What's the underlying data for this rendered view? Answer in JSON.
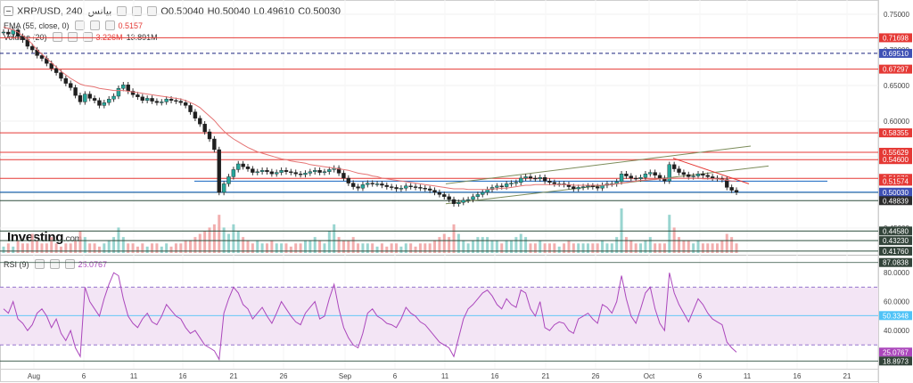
{
  "header": {
    "symbol": "XRP/USD, 240, بيانس",
    "ohlc": {
      "o": "O0.50040",
      "h": "H0.50040",
      "l": "L0.49610",
      "c": "C0.50030"
    },
    "ema_label": "EMA (55, close, 0)",
    "ema_value": "0.5157",
    "volume_label": "Volume (20)",
    "volume_value1": "3.226M",
    "volume_value2": "13.891M",
    "rsi_label": "RSI (9)",
    "rsi_value": "25.0767",
    "logo": "Investing",
    "logo_suffix": ".com"
  },
  "colors": {
    "up": "#26a69a",
    "down": "#1f1f1f",
    "ema": "#e57373",
    "resistance": "#e53935",
    "current_line": "#1565c0",
    "dashed_line": "#1a237e",
    "channel": "#7c8c5a",
    "rsi_line": "#ab47bc",
    "rsi_band": "#f3e5f5",
    "label_red": "#e53935",
    "label_blue": "#3f51b5",
    "label_dark": "#2b2b2b",
    "label_darkgreen": "#33443a"
  },
  "chart_data": [
    {
      "type": "candlestick",
      "title": "XRP/USD, 240",
      "ylim": [
        0.415,
        0.76
      ],
      "y_axis_ticks": [
        "0.75000",
        "0.70000",
        "0.65000",
        "0.60000",
        "0.55000",
        "0.50000",
        "0.45000"
      ],
      "x_axis_ticks": [
        "Aug",
        "6",
        "11",
        "16",
        "21",
        "26",
        "Sep",
        "6",
        "11",
        "16",
        "21",
        "26",
        "Oct",
        "6",
        "11",
        "16",
        "21"
      ],
      "price_labels": [
        {
          "value": 0.71698,
          "text": "0.71698",
          "style": "red"
        },
        {
          "value": 0.6951,
          "text": "0.69510",
          "style": "blue"
        },
        {
          "value": 0.67297,
          "text": "0.67297",
          "style": "red"
        },
        {
          "value": 0.58355,
          "text": "0.58355",
          "style": "red"
        },
        {
          "value": 0.55629,
          "text": "0.55629",
          "style": "red"
        },
        {
          "value": 0.546,
          "text": "0.54600",
          "style": "red"
        },
        {
          "value": 0.5197,
          "text": "0.51970",
          "style": "red"
        },
        {
          "value": 0.51574,
          "text": "0.51574",
          "style": "red"
        },
        {
          "value": 0.5,
          "text": "0.50000",
          "style": "dark"
        },
        {
          "value": 0.5003,
          "text": "0.50030",
          "style": "blue"
        },
        {
          "value": 0.48839,
          "text": "0.48839",
          "style": "dark"
        },
        {
          "value": 0.4458,
          "text": "0.44580",
          "style": "darkgreen"
        },
        {
          "value": 0.4323,
          "text": "0.43230",
          "style": "darkgreen"
        },
        {
          "value": 0.4176,
          "text": "0.41760",
          "style": "darkgreen"
        }
      ],
      "close_series": [
        0.725,
        0.722,
        0.728,
        0.719,
        0.714,
        0.705,
        0.7,
        0.692,
        0.688,
        0.681,
        0.674,
        0.668,
        0.66,
        0.653,
        0.647,
        0.636,
        0.627,
        0.638,
        0.632,
        0.629,
        0.622,
        0.626,
        0.631,
        0.635,
        0.646,
        0.651,
        0.642,
        0.637,
        0.634,
        0.629,
        0.632,
        0.628,
        0.626,
        0.627,
        0.631,
        0.629,
        0.628,
        0.626,
        0.622,
        0.613,
        0.604,
        0.596,
        0.585,
        0.575,
        0.56,
        0.5,
        0.512,
        0.522,
        0.532,
        0.54,
        0.536,
        0.533,
        0.528,
        0.529,
        0.531,
        0.529,
        0.526,
        0.528,
        0.531,
        0.529,
        0.528,
        0.526,
        0.525,
        0.527,
        0.529,
        0.531,
        0.528,
        0.529,
        0.532,
        0.534,
        0.527,
        0.52,
        0.513,
        0.508,
        0.506,
        0.511,
        0.513,
        0.512,
        0.512,
        0.51,
        0.508,
        0.507,
        0.505,
        0.506,
        0.509,
        0.508,
        0.507,
        0.506,
        0.505,
        0.503,
        0.5,
        0.497,
        0.494,
        0.49,
        0.484,
        0.486,
        0.489,
        0.49,
        0.494,
        0.497,
        0.5,
        0.504,
        0.507,
        0.509,
        0.508,
        0.512,
        0.513,
        0.514,
        0.52,
        0.522,
        0.52,
        0.519,
        0.521,
        0.516,
        0.514,
        0.512,
        0.512,
        0.511,
        0.508,
        0.505,
        0.507,
        0.508,
        0.509,
        0.508,
        0.506,
        0.51,
        0.512,
        0.512,
        0.515,
        0.526,
        0.523,
        0.52,
        0.519,
        0.521,
        0.526,
        0.528,
        0.524,
        0.52,
        0.516,
        0.539,
        0.533,
        0.528,
        0.525,
        0.522,
        0.523,
        0.526,
        0.524,
        0.522,
        0.52,
        0.519,
        0.518,
        0.507,
        0.503,
        0.5003
      ],
      "volume_series": [
        2,
        3,
        2,
        4,
        3,
        3,
        6,
        4,
        3,
        3,
        5,
        3,
        2,
        3,
        3,
        4,
        7,
        5,
        3,
        3,
        2,
        3,
        4,
        5,
        8,
        5,
        3,
        3,
        2,
        3,
        2,
        3,
        3,
        2,
        3,
        2,
        3,
        3,
        4,
        4,
        5,
        6,
        7,
        8,
        9,
        12,
        8,
        6,
        9,
        7,
        5,
        4,
        3,
        4,
        3,
        3,
        4,
        3,
        3,
        3,
        2,
        3,
        3,
        4,
        4,
        5,
        4,
        3,
        7,
        9,
        5,
        4,
        4,
        5,
        3,
        3,
        3,
        3,
        2,
        3,
        2,
        3,
        3,
        2,
        3,
        3,
        2,
        3,
        3,
        3,
        4,
        5,
        6,
        5,
        9,
        6,
        4,
        3,
        4,
        5,
        5,
        5,
        4,
        4,
        3,
        4,
        4,
        5,
        6,
        5,
        3,
        3,
        4,
        3,
        3,
        3,
        2,
        3,
        4,
        3,
        3,
        3,
        3,
        3,
        3,
        4,
        3,
        3,
        5,
        14,
        5,
        4,
        3,
        3,
        4,
        5,
        3,
        3,
        3,
        12,
        8,
        5,
        4,
        4,
        3,
        4,
        3,
        3,
        3,
        3,
        4,
        6,
        5,
        3
      ],
      "ema_series": [
        0.732,
        0.73,
        0.728,
        0.725,
        0.72,
        0.715,
        0.708,
        0.7,
        0.694,
        0.688,
        0.682,
        0.676,
        0.67,
        0.665,
        0.66,
        0.656,
        0.652,
        0.65,
        0.649,
        0.648,
        0.646,
        0.645,
        0.644,
        0.643,
        0.643,
        0.643,
        0.642,
        0.641,
        0.64,
        0.639,
        0.638,
        0.637,
        0.636,
        0.635,
        0.634,
        0.633,
        0.632,
        0.631,
        0.629,
        0.626,
        0.623,
        0.619,
        0.613,
        0.607,
        0.601,
        0.593,
        0.586,
        0.58,
        0.575,
        0.571,
        0.567,
        0.563,
        0.56,
        0.557,
        0.555,
        0.553,
        0.551,
        0.549,
        0.547,
        0.546,
        0.544,
        0.543,
        0.542,
        0.541,
        0.539,
        0.538,
        0.537,
        0.536,
        0.535,
        0.534,
        0.533,
        0.532,
        0.531,
        0.529,
        0.527,
        0.526,
        0.525,
        0.523,
        0.522,
        0.52,
        0.519,
        0.518,
        0.517,
        0.516,
        0.515,
        0.514,
        0.513,
        0.512,
        0.511,
        0.51,
        0.509,
        0.508,
        0.507,
        0.506,
        0.505,
        0.505,
        0.505,
        0.504,
        0.504,
        0.504,
        0.504,
        0.504,
        0.505,
        0.505,
        0.506,
        0.506,
        0.507,
        0.508,
        0.509,
        0.51,
        0.51,
        0.511,
        0.511,
        0.511,
        0.511,
        0.511,
        0.511,
        0.511,
        0.511,
        0.51,
        0.51,
        0.51,
        0.51,
        0.51,
        0.51,
        0.51,
        0.511,
        0.511,
        0.512,
        0.513,
        0.514,
        0.515,
        0.516,
        0.517,
        0.517,
        0.518,
        0.518,
        0.519,
        0.519,
        0.52,
        0.52,
        0.52,
        0.52,
        0.52,
        0.52,
        0.52,
        0.519,
        0.519,
        0.519,
        0.519,
        0.518,
        0.517,
        0.516,
        0.5157
      ]
    },
    {
      "type": "line",
      "title": "RSI (9)",
      "ylim": [
        16,
        90
      ],
      "y_axis_ticks": [
        "80.0000",
        "60.0000",
        "40.0000",
        "20.0000"
      ],
      "levels": [
        70,
        30
      ],
      "value_labels": [
        {
          "value": 87.0838,
          "text": "87.0838",
          "style": "darkgreen"
        },
        {
          "value": 50.3348,
          "text": "50.3348",
          "style": "blue"
        },
        {
          "value": 25.0767,
          "text": "25.0767",
          "style": "rsi"
        },
        {
          "value": 18.8973,
          "text": "18.8973",
          "style": "darkgreen"
        }
      ],
      "series": [
        55,
        52,
        60,
        48,
        45,
        40,
        44,
        52,
        55,
        50,
        42,
        48,
        38,
        33,
        40,
        28,
        22,
        70,
        60,
        55,
        50,
        62,
        72,
        80,
        78,
        62,
        50,
        45,
        42,
        48,
        52,
        46,
        44,
        50,
        58,
        54,
        50,
        48,
        42,
        38,
        40,
        35,
        30,
        28,
        26,
        20,
        52,
        62,
        70,
        66,
        58,
        55,
        48,
        52,
        56,
        50,
        45,
        52,
        60,
        55,
        50,
        46,
        44,
        52,
        56,
        60,
        48,
        50,
        62,
        72,
        55,
        42,
        35,
        30,
        28,
        38,
        52,
        55,
        50,
        48,
        45,
        44,
        42,
        48,
        56,
        52,
        50,
        46,
        44,
        40,
        36,
        32,
        30,
        28,
        22,
        35,
        48,
        55,
        58,
        62,
        66,
        68,
        64,
        58,
        55,
        62,
        58,
        56,
        68,
        66,
        55,
        50,
        60,
        42,
        40,
        44,
        46,
        45,
        40,
        38,
        48,
        50,
        52,
        48,
        45,
        58,
        56,
        52,
        60,
        78,
        62,
        50,
        45,
        55,
        66,
        70,
        55,
        45,
        40,
        80,
        66,
        58,
        52,
        46,
        54,
        62,
        58,
        52,
        48,
        46,
        44,
        32,
        28,
        25
      ]
    }
  ]
}
